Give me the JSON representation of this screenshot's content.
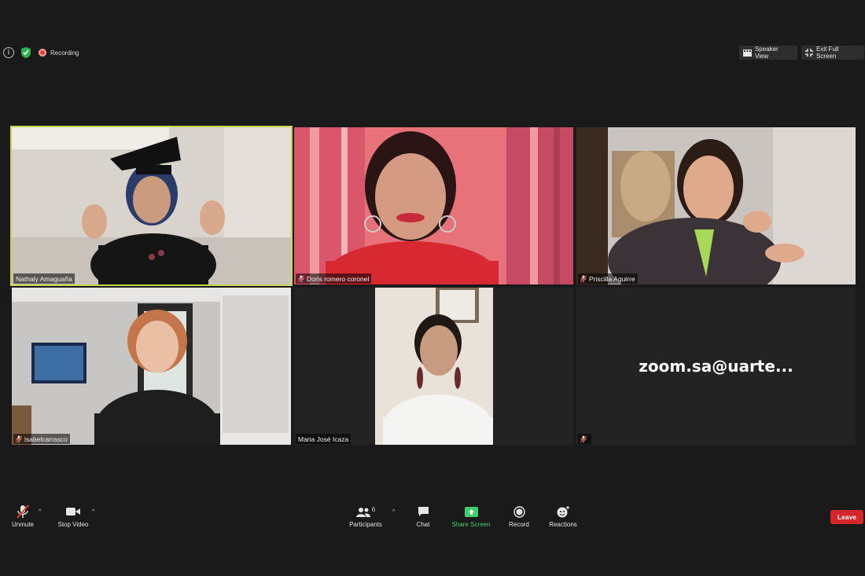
{
  "topbar": {
    "info_icon": "info-icon",
    "shield_icon": "shield-icon",
    "recording_label": "Recording",
    "speaker_view_label": "Speaker View",
    "exit_fullscreen_label": "Exit Full Screen"
  },
  "participants": [
    {
      "name": "Nathaly Amaguaña",
      "muted": false,
      "active_speaker": true
    },
    {
      "name": "Doris romero coronel",
      "muted": true,
      "active_speaker": false
    },
    {
      "name": "Priscilla Aguirre",
      "muted": true,
      "active_speaker": false
    },
    {
      "name": "isabelcarrasco",
      "muted": true,
      "active_speaker": false
    },
    {
      "name": "Maria José Icaza",
      "muted": false,
      "active_speaker": false
    },
    {
      "name": "zoom.sa@uarte...",
      "muted": true,
      "active_speaker": false
    }
  ],
  "toolbar": {
    "unmute_label": "Unmute",
    "stop_video_label": "Stop Video",
    "participants_label": "Participants",
    "participants_count": "6",
    "chat_label": "Chat",
    "share_screen_label": "Share Screen",
    "record_label": "Record",
    "reactions_label": "Reactions",
    "leave_label": "Leave"
  },
  "colors": {
    "background": "#1a1a1a",
    "active_speaker_border": "#c8d84e",
    "share_green": "#3fce68",
    "leave_red": "#d4262b",
    "recording_red": "#e8402f"
  }
}
